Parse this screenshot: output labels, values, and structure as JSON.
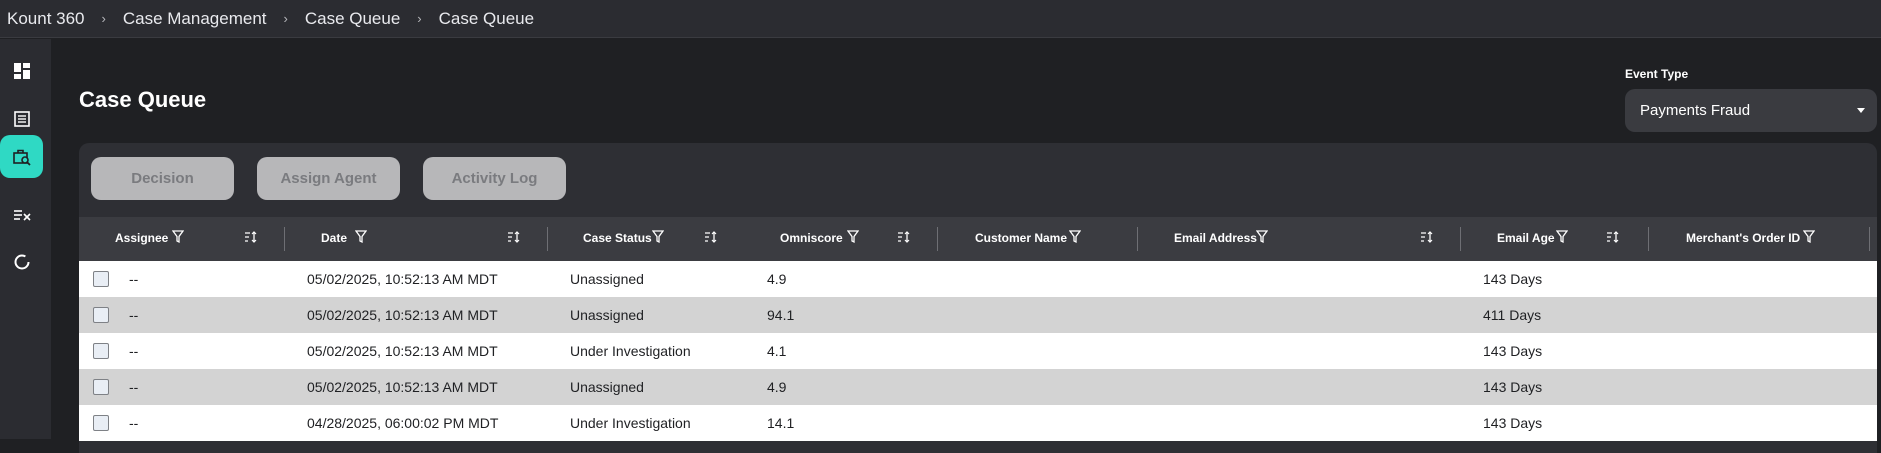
{
  "breadcrumb": {
    "items": [
      "Kount 360",
      "Case Management",
      "Case Queue",
      "Case Queue"
    ],
    "separator": "›"
  },
  "sidebar": {
    "items": [
      {
        "icon": "dashboard-icon"
      },
      {
        "icon": "list-icon"
      },
      {
        "icon": "case-search-icon",
        "active": true
      },
      {
        "icon": "checklist-icon"
      },
      {
        "icon": "refresh-icon"
      }
    ],
    "accent": "#2fd9c4"
  },
  "page": {
    "title": "Case Queue"
  },
  "event_type": {
    "label": "Event Type",
    "value": "Payments Fraud"
  },
  "toolbar": {
    "decision_label": "Decision",
    "assign_agent_label": "Assign Agent",
    "activity_log_label": "Activity Log"
  },
  "table": {
    "columns": [
      "Assignee",
      "Date",
      "Case Status",
      "Omniscore",
      "Customer Name",
      "Email Address",
      "Email Age",
      "Merchant's Order ID"
    ],
    "rows": [
      {
        "assignee": "--",
        "date": "05/02/2025, 10:52:13 AM MDT",
        "status": "Unassigned",
        "omniscore": "4.9",
        "customer": "",
        "email": "",
        "email_age": "143 Days",
        "order_id": ""
      },
      {
        "assignee": "--",
        "date": "05/02/2025, 10:52:13 AM MDT",
        "status": "Unassigned",
        "omniscore": "94.1",
        "customer": "",
        "email": "",
        "email_age": "411 Days",
        "order_id": ""
      },
      {
        "assignee": "--",
        "date": "05/02/2025, 10:52:13 AM MDT",
        "status": "Under Investigation",
        "omniscore": "4.1",
        "customer": "",
        "email": "",
        "email_age": "143 Days",
        "order_id": ""
      },
      {
        "assignee": "--",
        "date": "05/02/2025, 10:52:13 AM MDT",
        "status": "Unassigned",
        "omniscore": "4.9",
        "customer": "",
        "email": "",
        "email_age": "143 Days",
        "order_id": ""
      },
      {
        "assignee": "--",
        "date": "04/28/2025, 06:00:02 PM MDT",
        "status": "Under Investigation",
        "omniscore": "14.1",
        "customer": "",
        "email": "",
        "email_age": "143 Days",
        "order_id": ""
      }
    ]
  }
}
